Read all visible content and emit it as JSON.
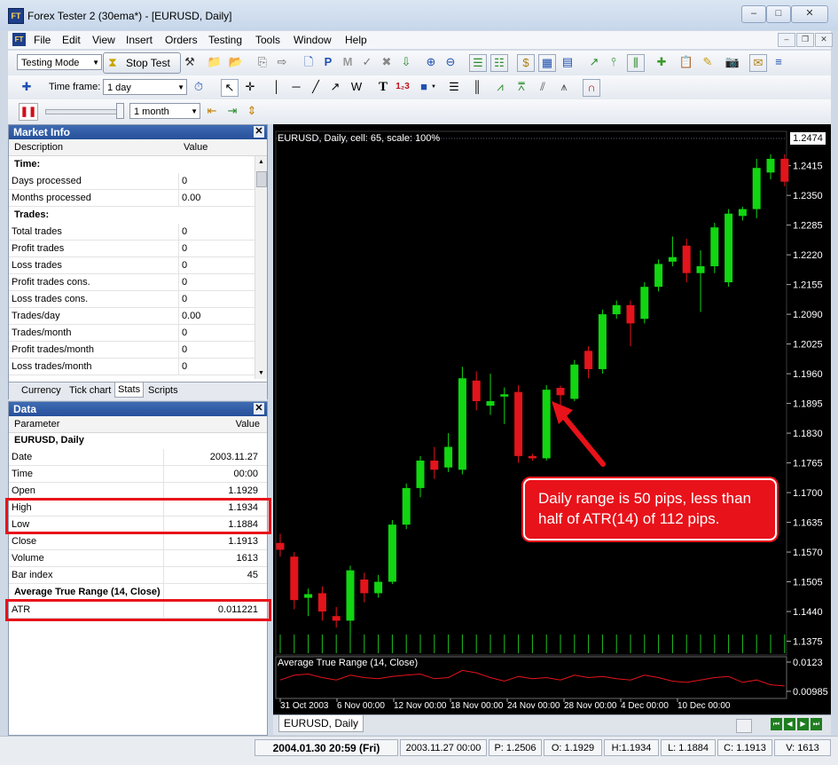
{
  "window": {
    "title": "Forex Tester 2  (30ema*) - [EURUSD, Daily]",
    "app_icon": "FT"
  },
  "menu": [
    "File",
    "Edit",
    "View",
    "Insert",
    "Orders",
    "Testing",
    "Tools",
    "Window",
    "Help"
  ],
  "toolbar": {
    "testing_mode": "Testing Mode",
    "stop_test": "Stop Test",
    "time_frame_label": "Time frame:",
    "time_frame_value": "1 day",
    "speed_period": "1 month",
    "text_tool": "T"
  },
  "market_info": {
    "title": "Market Info",
    "col_description": "Description",
    "col_value": "Value",
    "time_section": "Time:",
    "time_rows": [
      {
        "label": "Days processed",
        "value": "0"
      },
      {
        "label": "Months processed",
        "value": "0.00"
      }
    ],
    "trades_section": "Trades:",
    "trade_rows": [
      {
        "label": "Total trades",
        "value": "0"
      },
      {
        "label": "Profit trades",
        "value": "0"
      },
      {
        "label": "Loss trades",
        "value": "0"
      },
      {
        "label": "Profit trades cons.",
        "value": "0"
      },
      {
        "label": "Loss trades cons.",
        "value": "0"
      },
      {
        "label": "Trades/day",
        "value": "0.00"
      },
      {
        "label": "Trades/month",
        "value": "0"
      },
      {
        "label": "Profit trades/month",
        "value": "0"
      },
      {
        "label": "Loss trades/month",
        "value": "0"
      }
    ],
    "tabs": [
      "Currency",
      "Tick chart",
      "Stats",
      "Scripts"
    ],
    "active_tab": "Stats"
  },
  "data_panel": {
    "title": "Data",
    "col_parameter": "Parameter",
    "col_value": "Value",
    "symbol_section": "EURUSD, Daily",
    "rows": [
      {
        "label": "Date",
        "value": "2003.11.27"
      },
      {
        "label": "Time",
        "value": "00:00"
      },
      {
        "label": "Open",
        "value": "1.1929"
      },
      {
        "label": "High",
        "value": "1.1934"
      },
      {
        "label": "Low",
        "value": "1.1884"
      },
      {
        "label": "Close",
        "value": "1.1913"
      },
      {
        "label": "Volume",
        "value": "1613"
      },
      {
        "label": "Bar index",
        "value": "45"
      }
    ],
    "indicator_section": "Average True Range (14, Close)",
    "indicator_row": {
      "label": "ATR",
      "value": "0.011221"
    }
  },
  "chart": {
    "header": "EURUSD, Daily, cell: 65, scale: 100%",
    "current_price": "1.2474",
    "price_ticks": [
      "1.2415",
      "1.2350",
      "1.2285",
      "1.2220",
      "1.2155",
      "1.2090",
      "1.2025",
      "1.1960",
      "1.1895",
      "1.1830",
      "1.1765",
      "1.1700",
      "1.1635",
      "1.1570",
      "1.1505",
      "1.1440",
      "1.1375"
    ],
    "indicator_label": "Average True Range (14, Close)",
    "indicator_ticks": [
      "0.0123",
      "0.00985"
    ],
    "date_ticks": [
      "31 Oct 2003",
      "6 Nov 00:00",
      "12 Nov 00:00",
      "18 Nov 00:00",
      "24 Nov 00:00",
      "28 Nov 00:00",
      "4 Dec 00:00",
      "10 Dec 00:00"
    ],
    "tab": "EURUSD, Daily",
    "annotation": "Daily range is 50 pips, less than half of ATR(14) of 112 pips.",
    "colors": {
      "bull": "#11d611",
      "bear": "#e3141b",
      "background": "#000000",
      "annotation": "#e8121a"
    }
  },
  "chart_data": {
    "type": "candlestick",
    "title": "EURUSD, Daily",
    "ylim": [
      1.1345,
      1.249
    ],
    "candles": [
      {
        "o": 1.159,
        "h": 1.161,
        "l": 1.156,
        "c": 1.1575
      },
      {
        "o": 1.156,
        "h": 1.157,
        "l": 1.1445,
        "c": 1.1465
      },
      {
        "o": 1.147,
        "h": 1.149,
        "l": 1.143,
        "c": 1.1478
      },
      {
        "o": 1.148,
        "h": 1.1495,
        "l": 1.142,
        "c": 1.144
      },
      {
        "o": 1.143,
        "h": 1.145,
        "l": 1.1405,
        "c": 1.142
      },
      {
        "o": 1.142,
        "h": 1.154,
        "l": 1.1385,
        "c": 1.153
      },
      {
        "o": 1.151,
        "h": 1.1525,
        "l": 1.146,
        "c": 1.148
      },
      {
        "o": 1.148,
        "h": 1.152,
        "l": 1.147,
        "c": 1.1505
      },
      {
        "o": 1.1505,
        "h": 1.164,
        "l": 1.15,
        "c": 1.163
      },
      {
        "o": 1.163,
        "h": 1.172,
        "l": 1.162,
        "c": 1.171
      },
      {
        "o": 1.171,
        "h": 1.178,
        "l": 1.169,
        "c": 1.177
      },
      {
        "o": 1.177,
        "h": 1.18,
        "l": 1.173,
        "c": 1.175
      },
      {
        "o": 1.1755,
        "h": 1.183,
        "l": 1.1745,
        "c": 1.18
      },
      {
        "o": 1.175,
        "h": 1.1975,
        "l": 1.174,
        "c": 1.195
      },
      {
        "o": 1.1945,
        "h": 1.1965,
        "l": 1.188,
        "c": 1.19
      },
      {
        "o": 1.189,
        "h": 1.196,
        "l": 1.187,
        "c": 1.19
      },
      {
        "o": 1.191,
        "h": 1.193,
        "l": 1.185,
        "c": 1.1915
      },
      {
        "o": 1.192,
        "h": 1.1935,
        "l": 1.1765,
        "c": 1.178
      },
      {
        "o": 1.178,
        "h": 1.1785,
        "l": 1.177,
        "c": 1.1775
      },
      {
        "o": 1.1775,
        "h": 1.1935,
        "l": 1.177,
        "c": 1.1925
      },
      {
        "o": 1.1929,
        "h": 1.1934,
        "l": 1.1884,
        "c": 1.1913
      },
      {
        "o": 1.1905,
        "h": 1.199,
        "l": 1.19,
        "c": 1.198
      },
      {
        "o": 1.201,
        "h": 1.202,
        "l": 1.195,
        "c": 1.197
      },
      {
        "o": 1.197,
        "h": 1.21,
        "l": 1.196,
        "c": 1.209
      },
      {
        "o": 1.209,
        "h": 1.212,
        "l": 1.208,
        "c": 1.211
      },
      {
        "o": 1.211,
        "h": 1.212,
        "l": 1.202,
        "c": 1.207
      },
      {
        "o": 1.208,
        "h": 1.216,
        "l": 1.207,
        "c": 1.215
      },
      {
        "o": 1.215,
        "h": 1.221,
        "l": 1.214,
        "c": 1.22
      },
      {
        "o": 1.2205,
        "h": 1.226,
        "l": 1.2195,
        "c": 1.2215
      },
      {
        "o": 1.224,
        "h": 1.2255,
        "l": 1.216,
        "c": 1.218
      },
      {
        "o": 1.218,
        "h": 1.223,
        "l": 1.2095,
        "c": 1.2195
      },
      {
        "o": 1.2195,
        "h": 1.229,
        "l": 1.218,
        "c": 1.228
      },
      {
        "o": 1.216,
        "h": 1.232,
        "l": 1.215,
        "c": 1.231
      },
      {
        "o": 1.2305,
        "h": 1.2325,
        "l": 1.2295,
        "c": 1.232
      },
      {
        "o": 1.232,
        "h": 1.243,
        "l": 1.23,
        "c": 1.241
      },
      {
        "o": 1.24,
        "h": 1.244,
        "l": 1.2385,
        "c": 1.243
      },
      {
        "o": 1.243,
        "h": 1.244,
        "l": 1.237,
        "c": 1.238
      }
    ],
    "atr": [
      0.0108,
      0.0112,
      0.0113,
      0.011,
      0.0108,
      0.0112,
      0.011,
      0.0109,
      0.0111,
      0.0112,
      0.0113,
      0.0109,
      0.011,
      0.0116,
      0.0114,
      0.011,
      0.0107,
      0.0111,
      0.0109,
      0.011,
      0.0108,
      0.0112,
      0.011,
      0.0111,
      0.0109,
      0.0108,
      0.0112,
      0.011,
      0.0107,
      0.0106,
      0.0108,
      0.011,
      0.0111,
      0.0106,
      0.0108,
      0.0104,
      0.0103
    ],
    "atr_ylim": [
      0.0094,
      0.0126
    ]
  },
  "status": {
    "datetime": "2004.01.30 20:59 (Fri)",
    "bar_time": "2003.11.27 00:00",
    "price": "P: 1.2506",
    "open": "O: 1.1929",
    "high": "H:1.1934",
    "low": "L: 1.1884",
    "close": "C: 1.1913",
    "volume": "V: 1613"
  }
}
